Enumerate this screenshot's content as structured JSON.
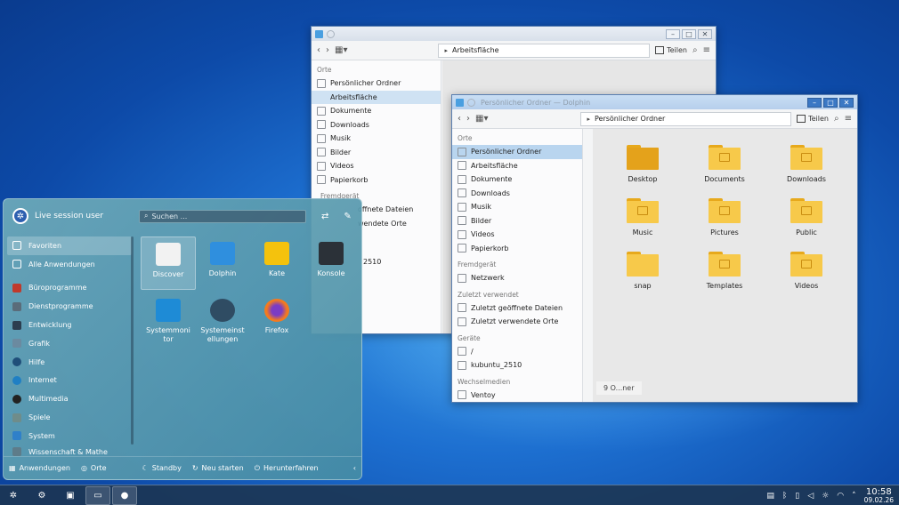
{
  "back_window": {
    "path": "Arbeitsfläche",
    "teilen": "Teilen",
    "sections": {
      "places": "Orte",
      "remote_partial": "Fremdgerät",
      "recent_files_partial": "offnete Dateien",
      "recent_places_partial": "wendete Orte",
      "device_partial": "2510"
    },
    "places": [
      "Persönlicher Ordner",
      "Arbeitsfläche",
      "Dokumente",
      "Downloads",
      "Musik",
      "Bilder",
      "Videos",
      "Papierkorb"
    ]
  },
  "front_window": {
    "title": "Persönlicher Ordner — Dolphin",
    "path": "Persönlicher Ordner",
    "teilen": "Teilen",
    "sections": {
      "places": "Orte",
      "remote": "Fremdgerät",
      "recent": "Zuletzt verwendet",
      "devices": "Geräte",
      "removable": "Wechselmedien"
    },
    "places": [
      "Persönlicher Ordner",
      "Arbeitsfläche",
      "Dokumente",
      "Downloads",
      "Musik",
      "Bilder",
      "Videos",
      "Papierkorb"
    ],
    "remote": [
      "Netzwerk"
    ],
    "recent": [
      "Zuletzt geöffnete Dateien",
      "Zuletzt verwendete Orte"
    ],
    "devices": [
      "/",
      "kubuntu_2510"
    ],
    "removable": [
      "Ventoy"
    ],
    "folders": [
      "Desktop",
      "Documents",
      "Downloads",
      "Music",
      "Pictures",
      "Public",
      "snap",
      "Templates",
      "Videos"
    ],
    "status": "9 O...ner"
  },
  "launcher": {
    "user": "Live session user",
    "search_placeholder": "Suchen ...",
    "categories": [
      "Favoriten",
      "Alle Anwendungen",
      "Büroprogramme",
      "Dienstprogramme",
      "Entwicklung",
      "Grafik",
      "Hilfe",
      "Internet",
      "Multimedia",
      "Spiele",
      "System",
      "Wissenschaft & Mathe"
    ],
    "apps": [
      "Discover",
      "Dolphin",
      "Kate",
      "Konsole",
      "Systemmonitor",
      "Systemeinstellungen",
      "Firefox"
    ],
    "footer": {
      "apps": "Anwendungen",
      "places": "Orte",
      "standby": "Standby",
      "restart": "Neu starten",
      "shutdown": "Herunterfahren"
    }
  },
  "taskbar": {
    "time": "10:58",
    "date": "09.02.26"
  },
  "colors": {
    "accent": "#3b78c4",
    "folder": "#f7c94a",
    "selection": "#cfe2f3"
  }
}
